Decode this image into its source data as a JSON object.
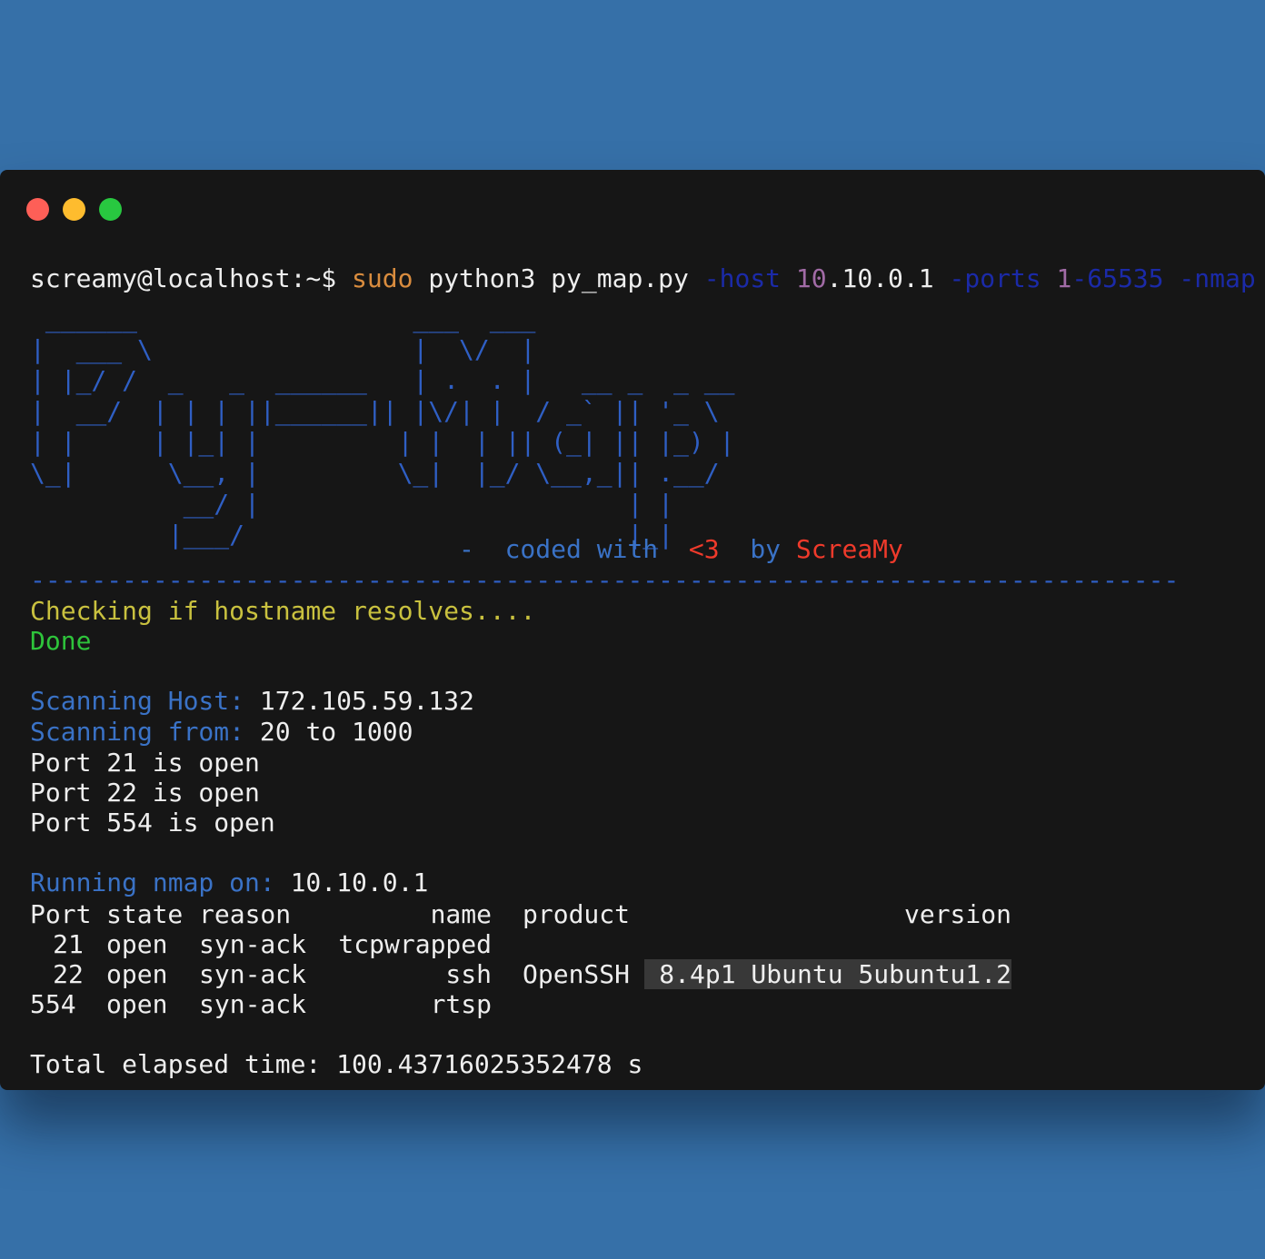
{
  "prompt": {
    "user_host": "screamy@localhost:~$",
    "cmd_sudo": "sudo",
    "cmd_rest": "python3 py_map.py",
    "flag_host": "-host",
    "host_part1": "10",
    "host_part2": ".10.0.1",
    "flag_ports": "-ports",
    "ports_value": "1-65535",
    "flag_nmap": "-nmap"
  },
  "banner": {
    "art": " ______                  ___  ___\n|  ___ \\                 |  \\/  |\n| |_/ /  _   _  ______   | .  . |   __ _  _ __\n|  __/  | | | ||______|| |\\/| |  / _` || '_ \\\n| |     | |_| |         | |  | || (_| || |_) |\n\\_|      \\__, |         \\_|  |_/ \\__,_|| .__/\n          __/ |                        | |\n         |___/                         |_|",
    "tag_dash": "-",
    "tag_coded": "coded with",
    "tag_heart": "<3",
    "tag_by": "by",
    "tag_author": "ScreaMy",
    "divider": "---------------------------------------------------------------------------"
  },
  "output": {
    "checking": "Checking if hostname resolves....",
    "done": "Done",
    "scan_host_label": "Scanning Host:",
    "scan_host_value": "172.105.59.132",
    "scan_from_label": "Scanning from:",
    "scan_from_value": "20 to 1000",
    "open_ports": [
      "Port 21 is open",
      "Port 22 is open",
      "Port 554 is open"
    ],
    "nmap_label": "Running nmap on:",
    "nmap_value": "10.10.0.1",
    "total_time": "Total elapsed time: 100.43716025352478 s"
  },
  "nmap_table": {
    "headers": [
      "Port",
      "state",
      "reason",
      "name",
      "product",
      "version"
    ],
    "rows": [
      [
        "21",
        "open",
        "syn-ack",
        "tcpwrapped",
        "",
        ""
      ],
      [
        "22",
        "open",
        "syn-ack",
        "ssh",
        "OpenSSH",
        "8.4p1 Ubuntu 5ubuntu1.2"
      ],
      [
        "554",
        "open",
        "syn-ack",
        "rtsp",
        "",
        ""
      ]
    ]
  },
  "colors": {
    "background": "#3670a8",
    "terminal": "#161616",
    "banner_blue": "#2f5fc4",
    "label_blue": "#3a72c6",
    "prompt_orange": "#d98c3e",
    "checking_yellow": "#c9c13f",
    "done_green": "#2ec43b",
    "author_red": "#ef3a2b"
  }
}
